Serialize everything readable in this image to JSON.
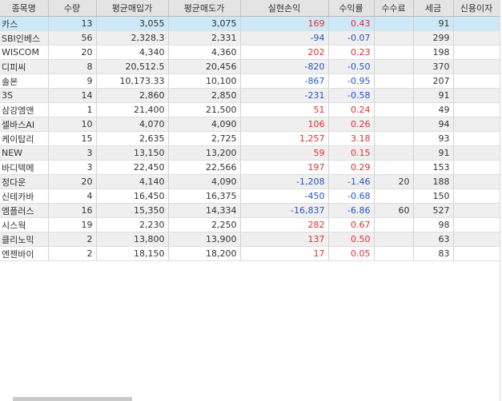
{
  "columns": [
    "종목명",
    "수량",
    "평균매입가",
    "평균매도가",
    "실현손익",
    "수익률",
    "수수료",
    "세금",
    "신용이자"
  ],
  "rows": [
    {
      "name": "카스",
      "qty": "13",
      "buy": "3,055",
      "sell": "3,075",
      "pnl": "169",
      "rate": "0.43",
      "fee": "",
      "tax": "91",
      "interest": "",
      "sign": "pos",
      "selected": true
    },
    {
      "name": "SBI인베스",
      "qty": "56",
      "buy": "2,328.3",
      "sell": "2,331",
      "pnl": "-94",
      "rate": "-0.07",
      "fee": "",
      "tax": "299",
      "interest": "",
      "sign": "neg"
    },
    {
      "name": "WISCOM",
      "qty": "20",
      "buy": "4,340",
      "sell": "4,360",
      "pnl": "202",
      "rate": "0.23",
      "fee": "",
      "tax": "198",
      "interest": "",
      "sign": "pos"
    },
    {
      "name": "디피씨",
      "qty": "8",
      "buy": "20,512.5",
      "sell": "20,456",
      "pnl": "-820",
      "rate": "-0.50",
      "fee": "",
      "tax": "370",
      "interest": "",
      "sign": "neg"
    },
    {
      "name": "솔본",
      "qty": "9",
      "buy": "10,173.33",
      "sell": "10,100",
      "pnl": "-867",
      "rate": "-0.95",
      "fee": "",
      "tax": "207",
      "interest": "",
      "sign": "neg"
    },
    {
      "name": "3S",
      "qty": "14",
      "buy": "2,860",
      "sell": "2,850",
      "pnl": "-231",
      "rate": "-0.58",
      "fee": "",
      "tax": "91",
      "interest": "",
      "sign": "neg"
    },
    {
      "name": "삼강엠앤",
      "qty": "1",
      "buy": "21,400",
      "sell": "21,500",
      "pnl": "51",
      "rate": "0.24",
      "fee": "",
      "tax": "49",
      "interest": "",
      "sign": "pos"
    },
    {
      "name": "셀바스AI",
      "qty": "10",
      "buy": "4,070",
      "sell": "4,090",
      "pnl": "106",
      "rate": "0.26",
      "fee": "",
      "tax": "94",
      "interest": "",
      "sign": "pos"
    },
    {
      "name": "케이탑리",
      "qty": "15",
      "buy": "2,635",
      "sell": "2,725",
      "pnl": "1,257",
      "rate": "3.18",
      "fee": "",
      "tax": "93",
      "interest": "",
      "sign": "pos"
    },
    {
      "name": "NEW",
      "qty": "3",
      "buy": "13,150",
      "sell": "13,200",
      "pnl": "59",
      "rate": "0.15",
      "fee": "",
      "tax": "91",
      "interest": "",
      "sign": "pos"
    },
    {
      "name": "바디텍메",
      "qty": "3",
      "buy": "22,450",
      "sell": "22,566",
      "pnl": "197",
      "rate": "0.29",
      "fee": "",
      "tax": "153",
      "interest": "",
      "sign": "pos"
    },
    {
      "name": "정다운",
      "qty": "20",
      "buy": "4,140",
      "sell": "4,090",
      "pnl": "-1,208",
      "rate": "-1.46",
      "fee": "20",
      "tax": "188",
      "interest": "",
      "sign": "neg"
    },
    {
      "name": "신테카바",
      "qty": "4",
      "buy": "16,450",
      "sell": "16,375",
      "pnl": "-450",
      "rate": "-0.68",
      "fee": "",
      "tax": "150",
      "interest": "",
      "sign": "neg"
    },
    {
      "name": "엠플러스",
      "qty": "16",
      "buy": "15,350",
      "sell": "14,334",
      "pnl": "-16,837",
      "rate": "-6.86",
      "fee": "60",
      "tax": "527",
      "interest": "",
      "sign": "neg"
    },
    {
      "name": "시스웍",
      "qty": "19",
      "buy": "2,230",
      "sell": "2,250",
      "pnl": "282",
      "rate": "0.67",
      "fee": "",
      "tax": "98",
      "interest": "",
      "sign": "pos"
    },
    {
      "name": "클리노믹",
      "qty": "2",
      "buy": "13,800",
      "sell": "13,900",
      "pnl": "137",
      "rate": "0.50",
      "fee": "",
      "tax": "63",
      "interest": "",
      "sign": "pos"
    },
    {
      "name": "엔젠바이",
      "qty": "2",
      "buy": "18,150",
      "sell": "18,200",
      "pnl": "17",
      "rate": "0.05",
      "fee": "",
      "tax": "83",
      "interest": "",
      "sign": "pos"
    }
  ]
}
